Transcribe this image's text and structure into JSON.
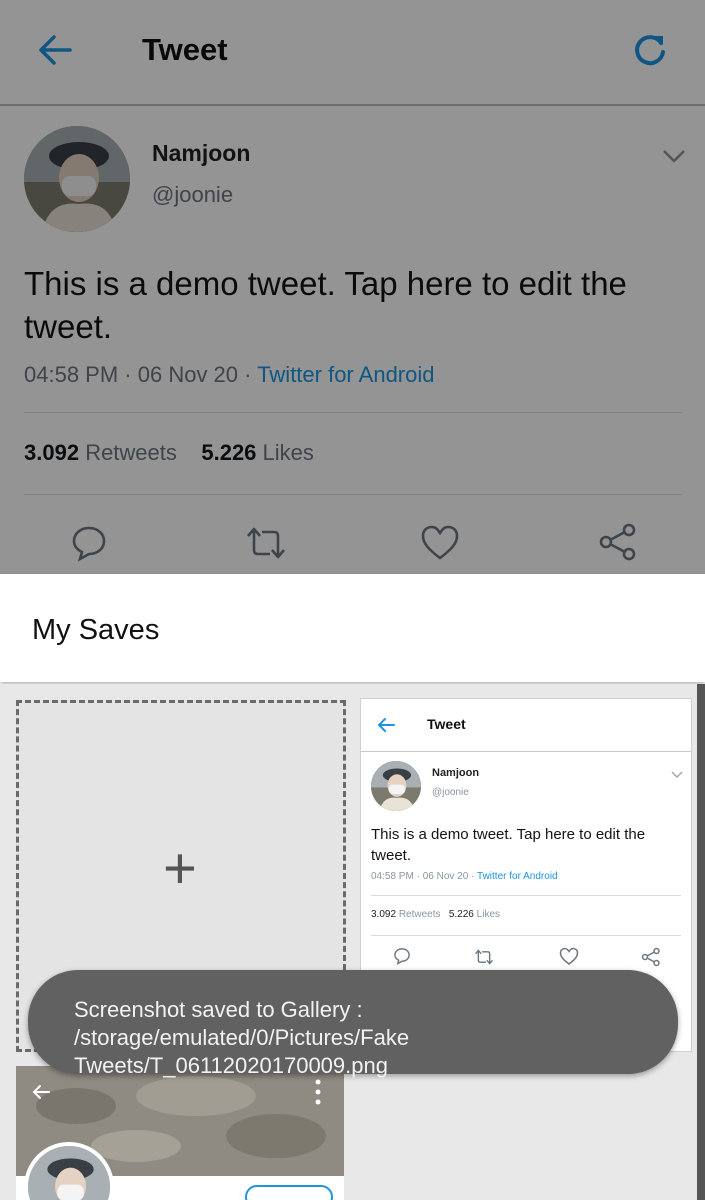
{
  "header": {
    "title": "Tweet",
    "back_icon": "arrow-left-icon",
    "refresh_icon": "refresh-icon"
  },
  "tweet": {
    "name": "Namjoon",
    "handle": "@joonie",
    "text": "This is a demo tweet. Tap here to edit the tweet.",
    "time": "04:58 PM",
    "date": "06 Nov 20",
    "source": "Twitter for Android",
    "retweets_count": "3.092",
    "retweets_label": "Retweets",
    "likes_count": "5.226",
    "likes_label": "Likes"
  },
  "saves": {
    "title": "My Saves",
    "add_symbol": "+",
    "thumbnail": {
      "title": "Tweet",
      "name": "Namjoon",
      "handle": "@joonie",
      "text": "This is a demo tweet. Tap here to edit the tweet.",
      "time": "04:58 PM",
      "date": "06 Nov 20",
      "source": "Twitter for Android",
      "retweets_count": "3.092",
      "retweets_label": "Retweets",
      "likes_count": "5.226",
      "likes_label": "Likes"
    }
  },
  "toast": {
    "message": "Screenshot saved to Gallery : /storage/emulated/0/Pictures/Fake Tweets/T_06112020170009.png"
  },
  "colors": {
    "accent": "#1b95e0",
    "toast_bg": "#616161",
    "overlay": "rgba(0,0,0,0.42)"
  }
}
